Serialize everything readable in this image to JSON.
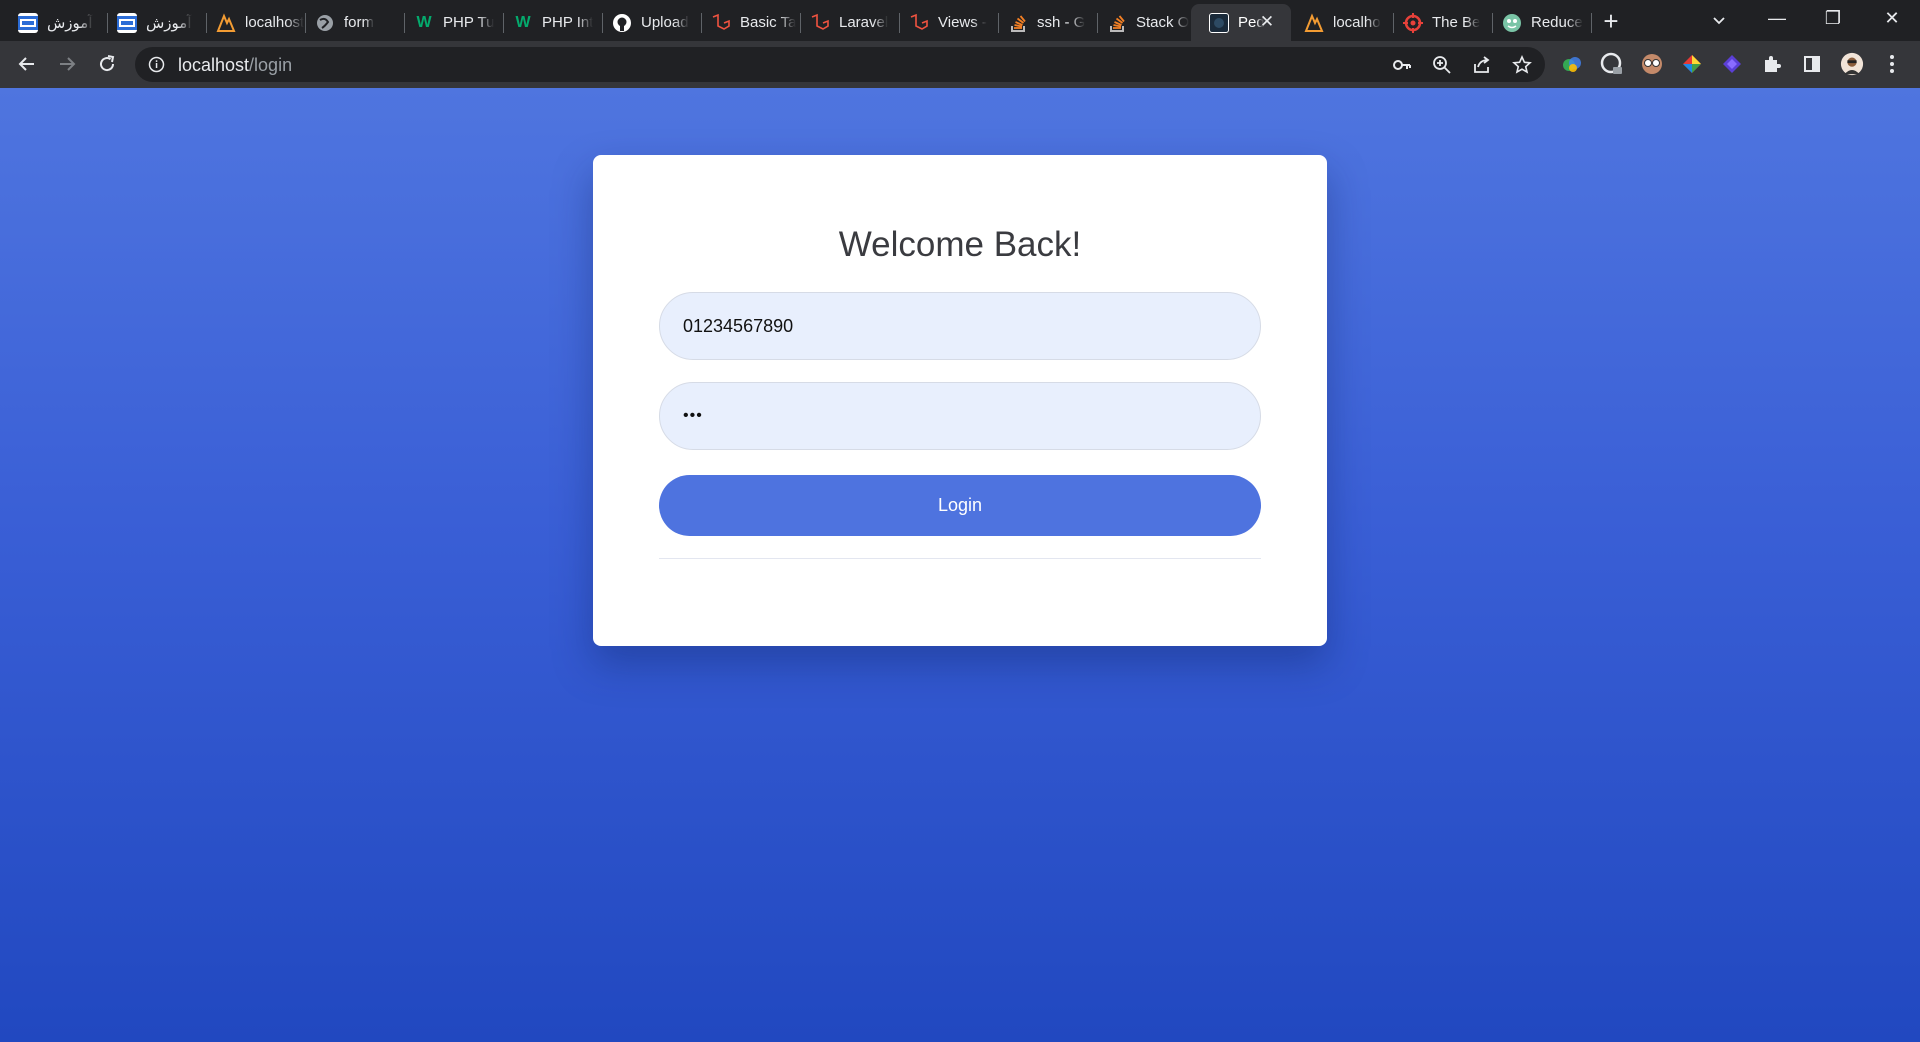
{
  "browser": {
    "tabs": [
      {
        "title": "آموزش",
        "rtl": true,
        "icon": "ir-flag-icon"
      },
      {
        "title": "آموزش",
        "rtl": true,
        "icon": "ir-flag-icon"
      },
      {
        "title": "localhost",
        "icon": "xampp-icon"
      },
      {
        "title": "form",
        "icon": "globe-icon"
      },
      {
        "title": "PHP Tu",
        "icon": "w3schools-icon"
      },
      {
        "title": "PHP Int",
        "icon": "w3schools-icon"
      },
      {
        "title": "Upload",
        "icon": "github-icon"
      },
      {
        "title": "Basic Ta",
        "icon": "laravel-icon"
      },
      {
        "title": "Laravel",
        "icon": "laravel-icon"
      },
      {
        "title": "Views -",
        "icon": "laravel-icon"
      },
      {
        "title": "ssh - G",
        "icon": "stackoverflow-icon"
      },
      {
        "title": "Stack O",
        "icon": "stackoverflow-icon"
      },
      {
        "title": "Ped",
        "icon": "pedantic-icon",
        "active": true
      },
      {
        "title": "localho",
        "icon": "xampp-icon"
      },
      {
        "title": "The Be",
        "icon": "target-icon"
      },
      {
        "title": "Reduce",
        "icon": "reduce-icon"
      }
    ],
    "new_tab_label": "+",
    "close_tab_label": "✕",
    "window": {
      "minimize": "—",
      "restore": "❐",
      "close": "✕"
    },
    "url": {
      "host": "localhost",
      "path": "/login"
    }
  },
  "page": {
    "heading": "Welcome Back!",
    "phone_input": {
      "value": "01234567890"
    },
    "password_input": {
      "value": "123"
    },
    "login_button": "Login"
  },
  "colors": {
    "page_gradient_top": "#4f75df",
    "page_gradient_bottom": "#2148c0",
    "button": "#4e73df",
    "input_bg": "#e8effd"
  }
}
